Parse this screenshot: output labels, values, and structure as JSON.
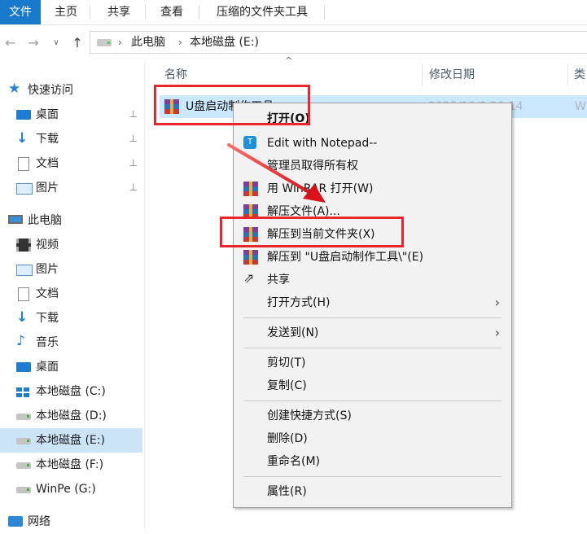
{
  "ribbon": {
    "tabs": [
      "文件",
      "主页",
      "共享",
      "查看",
      "压缩的文件夹工具"
    ]
  },
  "address": {
    "crumbs": [
      "此电脑",
      "本地磁盘 (E:)"
    ]
  },
  "sidebar": {
    "items": [
      {
        "label": "快速访问",
        "icon": "star-icon"
      },
      {
        "label": "桌面",
        "icon": "desktop-icon",
        "pinned": true
      },
      {
        "label": "下载",
        "icon": "download-icon",
        "pinned": true
      },
      {
        "label": "文档",
        "icon": "document-icon",
        "pinned": true
      },
      {
        "label": "图片",
        "icon": "picture-icon",
        "pinned": true
      },
      {
        "label": "此电脑",
        "icon": "computer-icon"
      },
      {
        "label": "视频",
        "icon": "video-icon"
      },
      {
        "label": "图片",
        "icon": "picture-icon"
      },
      {
        "label": "文档",
        "icon": "document-icon"
      },
      {
        "label": "下载",
        "icon": "download-icon"
      },
      {
        "label": "音乐",
        "icon": "music-icon"
      },
      {
        "label": "桌面",
        "icon": "desktop-icon"
      },
      {
        "label": "本地磁盘 (C:)",
        "icon": "windows-drive-icon"
      },
      {
        "label": "本地磁盘 (D:)",
        "icon": "drive-icon"
      },
      {
        "label": "本地磁盘 (E:)",
        "icon": "drive-icon",
        "selected": true
      },
      {
        "label": "本地磁盘 (F:)",
        "icon": "drive-icon"
      },
      {
        "label": "WinPe (G:)",
        "icon": "drive-icon"
      },
      {
        "label": "网络",
        "icon": "network-icon"
      }
    ],
    "pin_glyph": "📌"
  },
  "columns": {
    "name": "名称",
    "date": "修改日期",
    "type": "类"
  },
  "file": {
    "name": "U盘启动制作工具",
    "date": "2025/10/3 20:14",
    "type": "W"
  },
  "menu": {
    "open": "打开(O)",
    "notepad": "Edit with Notepad--",
    "ownership": "管理员取得所有权",
    "winrar_open": "用 WinRAR 打开(W)",
    "extract_files": "解压文件(A)...",
    "extract_here": "解压到当前文件夹(X)",
    "extract_to": "解压到 \"U盘启动制作工具\\\"(E)",
    "share": "共享",
    "open_with": "打开方式(H)",
    "send_to": "发送到(N)",
    "cut": "剪切(T)",
    "copy": "复制(C)",
    "create_shortcut": "创建快捷方式(S)",
    "delete": "删除(D)",
    "rename": "重命名(M)",
    "properties": "属性(R)"
  },
  "colors": {
    "accent": "#1979ca",
    "selection": "#cce8ff",
    "highlight": "#e8262b"
  }
}
